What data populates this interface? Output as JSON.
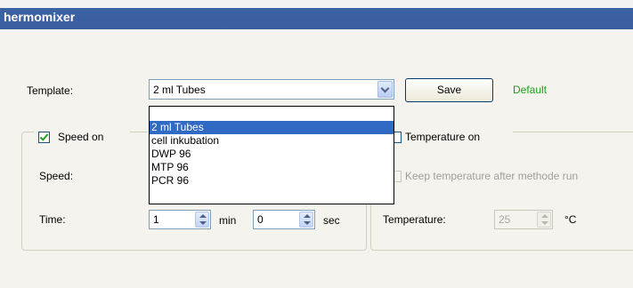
{
  "window": {
    "title": "hermomixer"
  },
  "template": {
    "label": "Template:",
    "selected": "2 ml Tubes",
    "options": [
      "2 ml Tubes",
      "cell inkubation",
      "DWP 96",
      "MTP 96",
      "PCR 96"
    ],
    "save_label": "Save",
    "status": "Default"
  },
  "speed_group": {
    "checkbox_label": "Speed on",
    "checked": true,
    "speed_label": "Speed:",
    "time_label": "Time:",
    "time_min_value": "1",
    "min_unit": "min",
    "time_sec_value": "0",
    "sec_unit": "sec"
  },
  "temperature_group": {
    "checkbox_label": "Temperature on",
    "keep_label": "Keep temperature after methode run",
    "temperature_label": "Temperature:",
    "temperature_value": "25",
    "unit": "°C"
  },
  "colors": {
    "titlebar": "#3a5fa0",
    "selection": "#316ac5",
    "default_status": "#1aa01a",
    "checkmark": "#21a121"
  }
}
